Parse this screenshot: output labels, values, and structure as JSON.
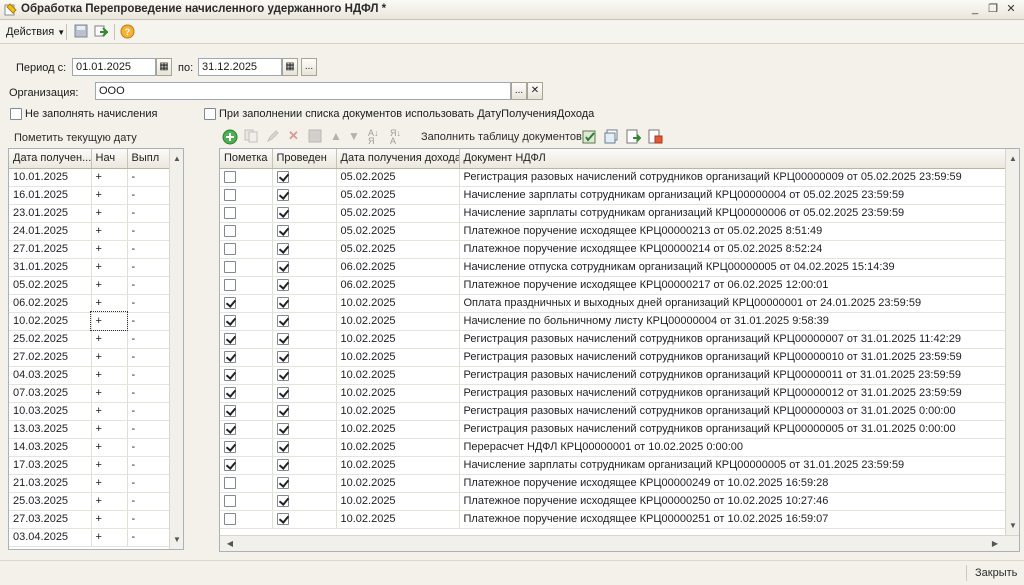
{
  "window": {
    "title": "Обработка  Перепроведение начисленного удержанного НДФЛ *"
  },
  "toolbar": {
    "actions_label": "Действия"
  },
  "period": {
    "from_label": "Период с:",
    "from_value": "01.01.2025",
    "to_label": "по:",
    "to_value": "31.12.2025",
    "more_label": "..."
  },
  "organization": {
    "label": "Организация:",
    "value": "ООО",
    "select_label": "...",
    "clear_label": "✕"
  },
  "options": {
    "no_fill_accruals_label": "Не заполнять начисления",
    "use_income_date_label": "При заполнении списка документов использовать ДатуПолученияДохода"
  },
  "left_panel": {
    "mark_current_date_label": "Пометить текущую дату",
    "columns": [
      "Дата получен...",
      "Нач",
      "Выпл"
    ],
    "rows": [
      [
        "10.01.2025",
        "+",
        "-"
      ],
      [
        "16.01.2025",
        "+",
        "-"
      ],
      [
        "23.01.2025",
        "+",
        "-"
      ],
      [
        "24.01.2025",
        "+",
        "-"
      ],
      [
        "27.01.2025",
        "+",
        "-"
      ],
      [
        "31.01.2025",
        "+",
        "-"
      ],
      [
        "05.02.2025",
        "+",
        "-"
      ],
      [
        "06.02.2025",
        "+",
        "-"
      ],
      [
        "10.02.2025",
        "+",
        "-"
      ],
      [
        "25.02.2025",
        "+",
        "-"
      ],
      [
        "27.02.2025",
        "+",
        "-"
      ],
      [
        "04.03.2025",
        "+",
        "-"
      ],
      [
        "07.03.2025",
        "+",
        "-"
      ],
      [
        "10.03.2025",
        "+",
        "-"
      ],
      [
        "13.03.2025",
        "+",
        "-"
      ],
      [
        "14.03.2025",
        "+",
        "-"
      ],
      [
        "17.03.2025",
        "+",
        "-"
      ],
      [
        "21.03.2025",
        "+",
        "-"
      ],
      [
        "25.03.2025",
        "+",
        "-"
      ],
      [
        "27.03.2025",
        "+",
        "-"
      ],
      [
        "03.04.2025",
        "+",
        "-"
      ]
    ]
  },
  "right_panel": {
    "fill_table_label": "Заполнить таблицу  документов",
    "columns": [
      "Пометка",
      "Проведен",
      "Дата получения дохода",
      "Документ НДФЛ"
    ],
    "rows": [
      {
        "mark": false,
        "posted": true,
        "date": "05.02.2025",
        "doc": "Регистрация разовых начислений сотрудников организаций КРЦ00000009 от 05.02.2025 23:59:59"
      },
      {
        "mark": false,
        "posted": true,
        "date": "05.02.2025",
        "doc": "Начисление зарплаты сотрудникам организаций КРЦ00000004 от 05.02.2025 23:59:59"
      },
      {
        "mark": false,
        "posted": true,
        "date": "05.02.2025",
        "doc": "Начисление зарплаты сотрудникам организаций КРЦ00000006 от 05.02.2025 23:59:59"
      },
      {
        "mark": false,
        "posted": true,
        "date": "05.02.2025",
        "doc": "Платежное поручение исходящее КРЦ00000213 от 05.02.2025 8:51:49"
      },
      {
        "mark": false,
        "posted": true,
        "date": "05.02.2025",
        "doc": "Платежное поручение исходящее КРЦ00000214 от 05.02.2025 8:52:24"
      },
      {
        "mark": false,
        "posted": true,
        "date": "06.02.2025",
        "doc": "Начисление отпуска сотрудникам организаций КРЦ00000005 от 04.02.2025 15:14:39"
      },
      {
        "mark": false,
        "posted": true,
        "date": "06.02.2025",
        "doc": "Платежное поручение исходящее КРЦ00000217 от 06.02.2025 12:00:01"
      },
      {
        "mark": true,
        "posted": true,
        "date": "10.02.2025",
        "doc": "Оплата праздничных и выходных дней организаций КРЦ00000001 от 24.01.2025 23:59:59"
      },
      {
        "mark": true,
        "posted": true,
        "date": "10.02.2025",
        "doc": "Начисление по больничному листу КРЦ00000004 от 31.01.2025 9:58:39"
      },
      {
        "mark": true,
        "posted": true,
        "date": "10.02.2025",
        "doc": "Регистрация разовых начислений сотрудников организаций КРЦ00000007 от 31.01.2025 11:42:29"
      },
      {
        "mark": true,
        "posted": true,
        "date": "10.02.2025",
        "doc": "Регистрация разовых начислений сотрудников организаций КРЦ00000010 от 31.01.2025 23:59:59"
      },
      {
        "mark": true,
        "posted": true,
        "date": "10.02.2025",
        "doc": "Регистрация разовых начислений сотрудников организаций КРЦ00000011 от 31.01.2025 23:59:59"
      },
      {
        "mark": true,
        "posted": true,
        "date": "10.02.2025",
        "doc": "Регистрация разовых начислений сотрудников организаций КРЦ00000012 от 31.01.2025 23:59:59"
      },
      {
        "mark": true,
        "posted": true,
        "date": "10.02.2025",
        "doc": "Регистрация разовых начислений сотрудников организаций КРЦ00000003 от 31.01.2025 0:00:00"
      },
      {
        "mark": true,
        "posted": true,
        "date": "10.02.2025",
        "doc": "Регистрация разовых начислений сотрудников организаций КРЦ00000005 от 31.01.2025 0:00:00"
      },
      {
        "mark": true,
        "posted": true,
        "date": "10.02.2025",
        "doc": "Перерасчет НДФЛ КРЦ00000001 от 10.02.2025 0:00:00"
      },
      {
        "mark": true,
        "posted": true,
        "date": "10.02.2025",
        "doc": "Начисление зарплаты сотрудникам организаций КРЦ00000005 от 31.01.2025 23:59:59"
      },
      {
        "mark": false,
        "posted": true,
        "date": "10.02.2025",
        "doc": "Платежное поручение исходящее КРЦ00000249 от 10.02.2025 16:59:28"
      },
      {
        "mark": false,
        "posted": true,
        "date": "10.02.2025",
        "doc": "Платежное поручение исходящее КРЦ00000250 от 10.02.2025 10:27:46"
      },
      {
        "mark": false,
        "posted": true,
        "date": "10.02.2025",
        "doc": "Платежное поручение исходящее КРЦ00000251 от 10.02.2025 16:59:07"
      }
    ]
  },
  "footer": {
    "close_label": "Закрыть"
  },
  "colors": {
    "accent": "#c8a400",
    "grid_border": "#a9b1ba",
    "window_bg": "#f3f1ea"
  }
}
